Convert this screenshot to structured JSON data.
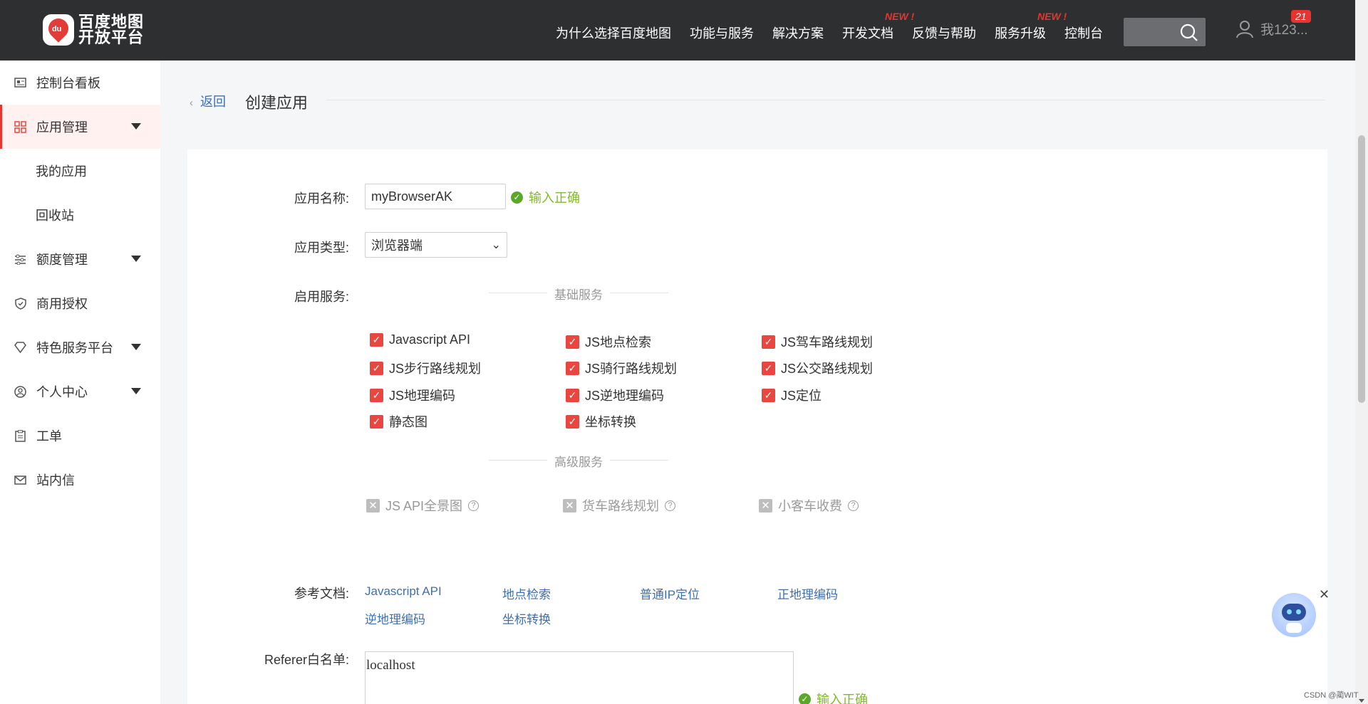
{
  "header": {
    "logo_line1": "百度地图",
    "logo_line2": "开放平台",
    "logo_mark": "du",
    "nav": [
      {
        "label": "为什么选择百度地图",
        "new": ""
      },
      {
        "label": "功能与服务",
        "new": ""
      },
      {
        "label": "解决方案",
        "new": ""
      },
      {
        "label": "开发文档",
        "new": "NEW !"
      },
      {
        "label": "反馈与帮助",
        "new": ""
      },
      {
        "label": "服务升级",
        "new": "NEW !"
      },
      {
        "label": "控制台",
        "new": ""
      }
    ],
    "user_name": "我123...",
    "notification_count": "21"
  },
  "sidebar": {
    "items": [
      {
        "label": "控制台看板",
        "icon": "dashboard-icon"
      },
      {
        "label": "应用管理",
        "icon": "grid-icon"
      },
      {
        "label": "我的应用"
      },
      {
        "label": "回收站"
      },
      {
        "label": "额度管理",
        "icon": "sliders-icon"
      },
      {
        "label": "商用授权",
        "icon": "shield-icon"
      },
      {
        "label": "特色服务平台",
        "icon": "diamond-icon"
      },
      {
        "label": "个人中心",
        "icon": "user-circle-icon"
      },
      {
        "label": "工单",
        "icon": "clipboard-icon"
      },
      {
        "label": "站内信",
        "icon": "mail-icon"
      }
    ]
  },
  "page": {
    "back_label": "返回",
    "title": "创建应用"
  },
  "form": {
    "app_name_label": "应用名称:",
    "app_name_value": "myBrowserAK",
    "app_name_status": "输入正确",
    "app_type_label": "应用类型:",
    "app_type_value": "浏览器端",
    "services_label": "启用服务:",
    "basic_section": "基础服务",
    "basic_services": [
      "Javascript API",
      "JS地点检索",
      "JS驾车路线规划",
      "JS步行路线规划",
      "JS骑行路线规划",
      "JS公交路线规划",
      "JS地理编码",
      "JS逆地理编码",
      "JS定位",
      "静态图",
      "坐标转换"
    ],
    "advanced_section": "高级服务",
    "advanced_services": [
      "JS API全景图",
      "货车路线规划",
      "小客车收费"
    ],
    "docs_label": "参考文档:",
    "docs": [
      "Javascript API",
      "地点检索",
      "普通IP定位",
      "正地理编码",
      "逆地理编码",
      "坐标转换"
    ],
    "referer_label": "Referer白名单:",
    "referer_value": "localhost",
    "referer_status": "输入正确"
  },
  "watermark": "CSDN @蔺WIT",
  "colors": {
    "accent": "#e8463f",
    "link": "#3e6fb5",
    "success": "#82b92c",
    "topbar": "#2d2f31"
  }
}
